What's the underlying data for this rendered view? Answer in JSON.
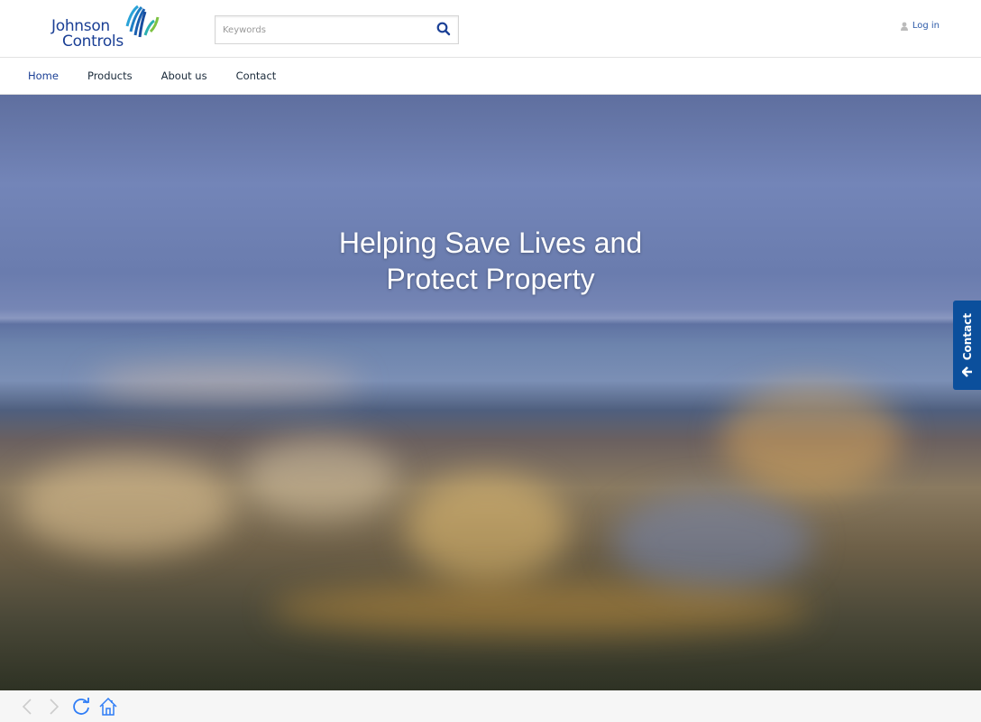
{
  "header": {
    "logo_line1": "Johnson",
    "logo_line2": "Controls",
    "search_placeholder": "Keywords",
    "login_label": "Log in"
  },
  "nav": {
    "items": [
      {
        "label": "Home",
        "active": true
      },
      {
        "label": "Products"
      },
      {
        "label": "About us"
      },
      {
        "label": "Contact"
      }
    ]
  },
  "hero": {
    "headline_line1": "Helping Save Lives and",
    "headline_line2": "Protect Property"
  },
  "contact_tab": {
    "label": "Contact"
  },
  "colors": {
    "brand": "#1a3f95",
    "accent": "#0b4f9c",
    "browser_icon": "#2f7df6"
  }
}
